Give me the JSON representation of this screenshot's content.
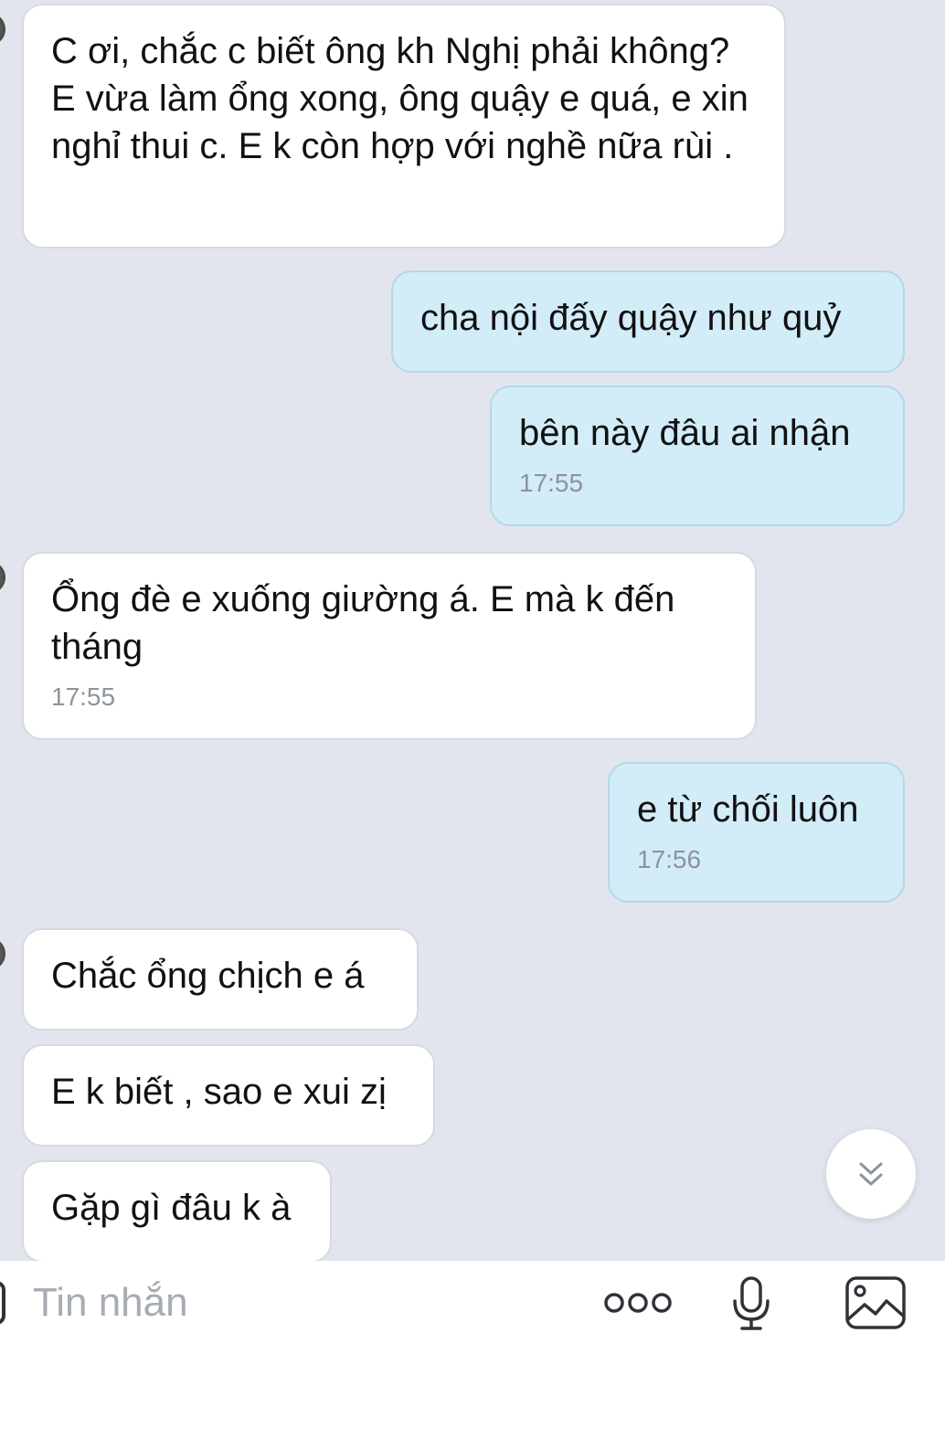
{
  "messages": [
    {
      "direction": "incoming",
      "text": "C ơi, chắc c biết ông kh Nghị phải không? E vừa làm ổng xong, ông quậy e quá, e xin nghỉ thui c. E k còn hợp với nghề nữa rùi .",
      "time": ""
    },
    {
      "direction": "outgoing",
      "text": "cha nội đấy quậy như quỷ",
      "time": ""
    },
    {
      "direction": "outgoing",
      "text": "bên này đâu ai nhận",
      "time": "17:55"
    },
    {
      "direction": "incoming",
      "text": "Ổng đè e xuống giường á. E mà k đến tháng",
      "time": "17:55"
    },
    {
      "direction": "outgoing",
      "text": "e từ chối luôn",
      "time": "17:56"
    },
    {
      "direction": "incoming",
      "text": "Chắc ổng chịch e á",
      "time": ""
    },
    {
      "direction": "incoming",
      "text": "E k biết , sao e xui zị",
      "time": ""
    },
    {
      "direction": "incoming",
      "text": "Gặp gì đâu k à",
      "time": ""
    }
  ],
  "composer": {
    "placeholder": "Tin nhắn",
    "icons": [
      "more-icon",
      "microphone-icon",
      "image-icon"
    ]
  },
  "scroll_button": {
    "icon": "chevron-double-down-icon"
  },
  "colors": {
    "background": "#e2e5ee",
    "incoming_bubble": "#ffffff",
    "outgoing_bubble": "#d2ecf8",
    "timestamp": "#8d939b",
    "placeholder": "#a6acb3",
    "icon": "#2f3338"
  }
}
